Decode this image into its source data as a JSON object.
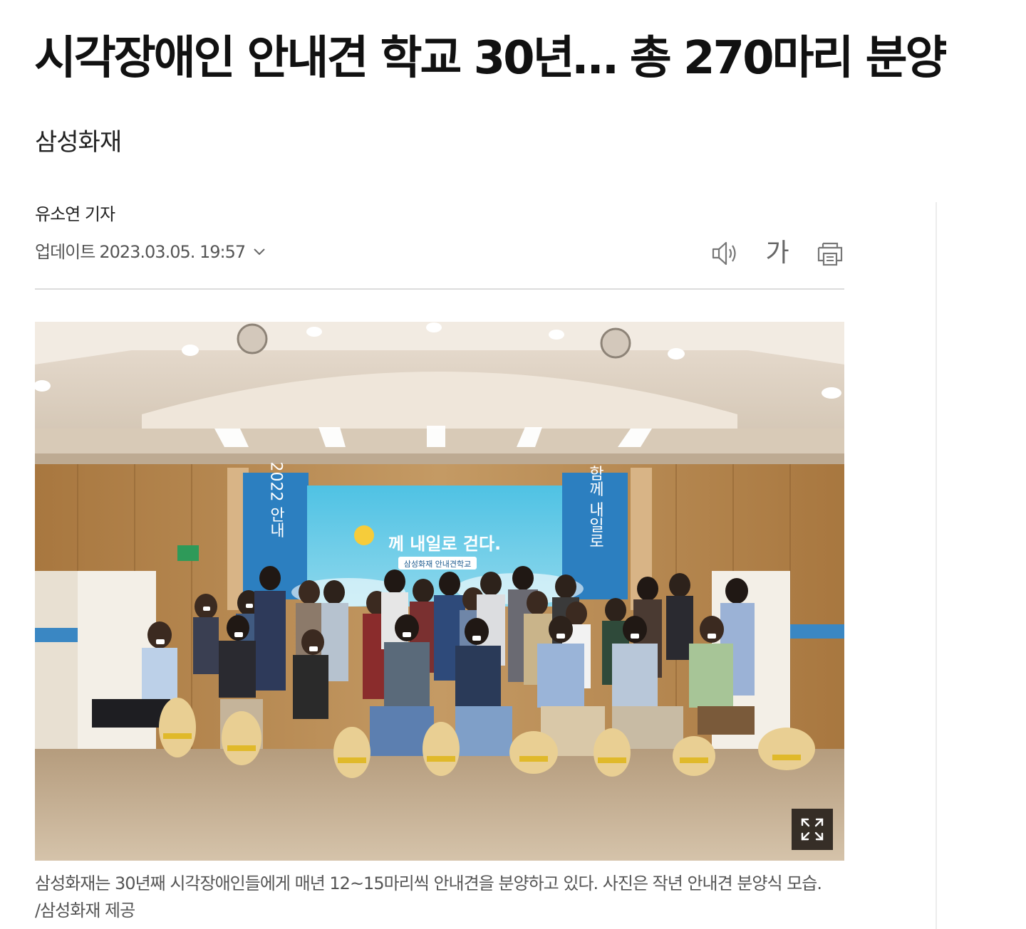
{
  "article": {
    "headline": "시각장애인 안내견 학교 30년… 총 270마리 분양",
    "source": "삼성화재",
    "byline": "유소연 기자",
    "updated_label": "업데이트",
    "updated_time": "2023.03.05. 19:57",
    "tools": {
      "listen_icon": "speaker-icon",
      "font_size_label": "가",
      "print_icon": "print-icon"
    },
    "photo": {
      "banner_left": "2022 안내",
      "banner_right": "함께 내일로",
      "screen_headline": "께 내일로 걷다.",
      "screen_sub": "삼성화재 안내견학교",
      "expand_icon": "expand-icon"
    },
    "caption": "삼성화재는 30년째 시각장애인들에게 매년 12~15마리씩 안내견을 분양하고 있다. 사진은 작년 안내견 분양식 모습. /삼성화재 제공"
  }
}
